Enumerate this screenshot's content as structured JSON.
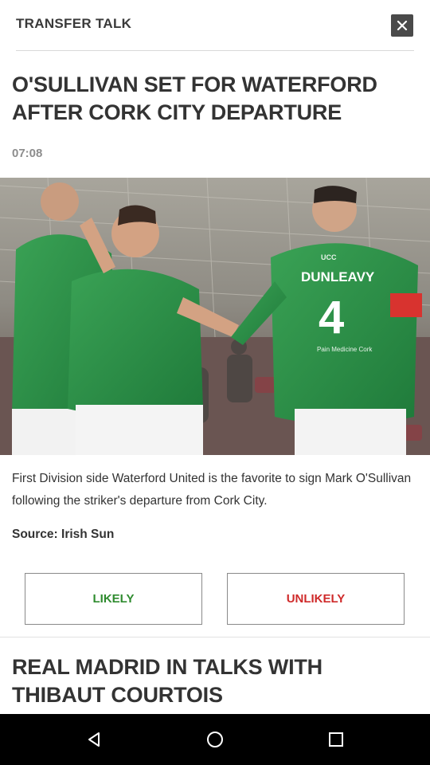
{
  "header": {
    "title": "TRANSFER TALK",
    "close_icon": "close-icon"
  },
  "article": {
    "headline": "O'SULLIVAN SET FOR WATERFORD AFTER CORK CITY DEPARTURE",
    "time": "07:08",
    "body": "First Division side Waterford United is the favorite to sign Mark O'Sullivan following the striker's departure from Cork City.",
    "source": "Source: Irish Sun",
    "photo_shirt_name": "DUNLEAVY",
    "photo_shirt_number": "4",
    "photo_sponsor": "Pain Medicine Cork",
    "photo_badge": "UCC"
  },
  "vote": {
    "likely_label": "LIKELY",
    "unlikely_label": "UNLIKELY",
    "likely_color": "#2e8b2e",
    "unlikely_color": "#cf2a2a"
  },
  "next_article": {
    "headline": "REAL MADRID IN TALKS WITH THIBAUT COURTOIS"
  },
  "navbar": {
    "back_icon": "back-triangle-icon",
    "home_icon": "home-circle-icon",
    "recent_icon": "recent-apps-square-icon"
  }
}
